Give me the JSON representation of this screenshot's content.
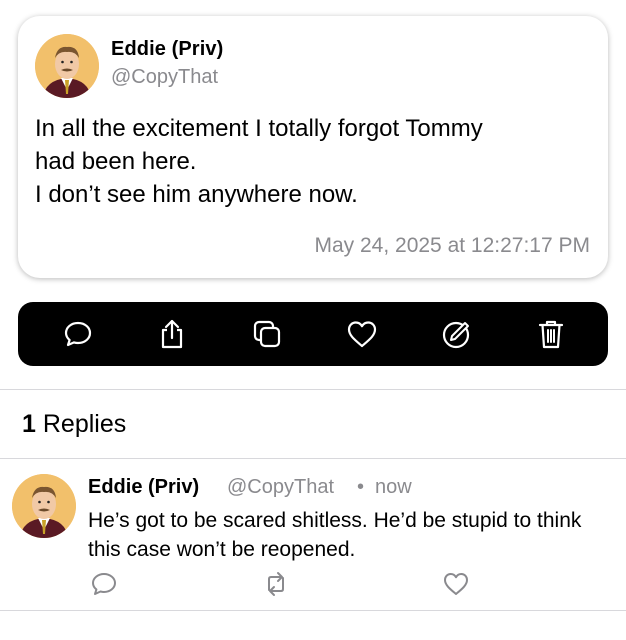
{
  "post": {
    "author_name": "Eddie (Priv)",
    "author_handle": "@CopyThat",
    "text": "In all the excitement I totally forgot Tommy\nhad been here.\nI don’t see him anywhere now.",
    "timestamp": "May 24, 2025 at 12:27:17 PM"
  },
  "actions": [
    {
      "name": "reply",
      "icon": "speech-bubble-icon"
    },
    {
      "name": "share",
      "icon": "share-icon"
    },
    {
      "name": "copy",
      "icon": "copy-icon"
    },
    {
      "name": "like",
      "icon": "heart-icon"
    },
    {
      "name": "edit",
      "icon": "edit-icon"
    },
    {
      "name": "delete",
      "icon": "trash-icon"
    }
  ],
  "replies_section": {
    "count": "1",
    "label": "Replies"
  },
  "reply": {
    "author_name": "Eddie (Priv)",
    "author_handle": "@CopyThat",
    "separator": "•",
    "time": "now",
    "text": "He’s got to be scared shitless. He’d be stupid to think this case won’t be reopened."
  },
  "colors": {
    "action_bar_bg": "#000000",
    "secondary_text": "#8a8a8e",
    "avatar_bg": "#f2c06b"
  }
}
